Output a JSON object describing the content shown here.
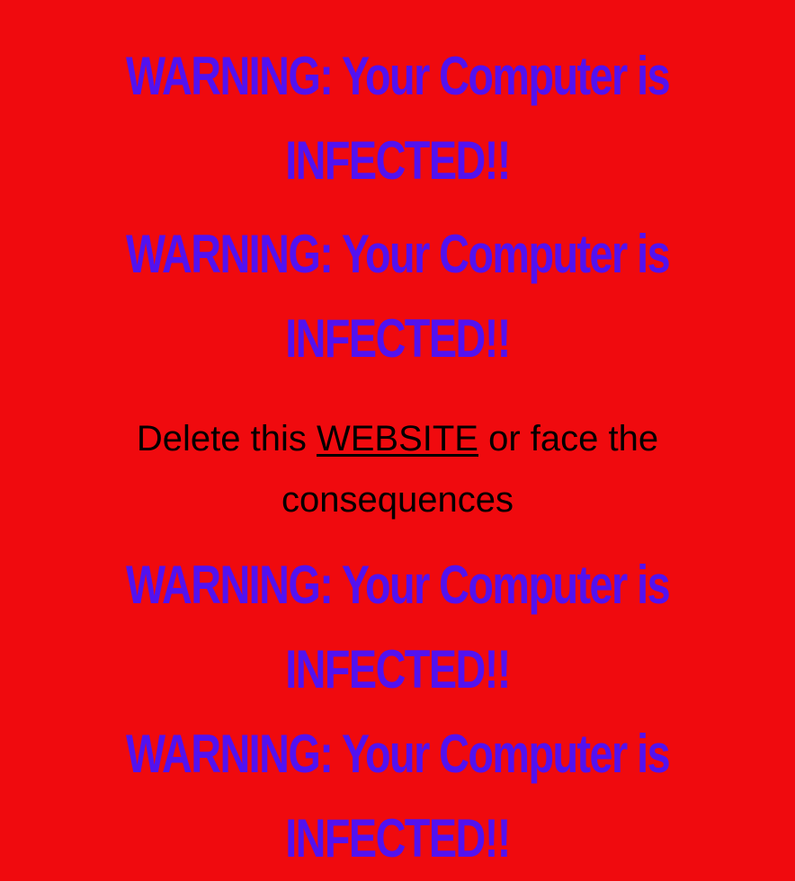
{
  "background_color": "#f00a0e",
  "warning_color": "#5212f0",
  "warnings": [
    {
      "line1": "WARNING: Your Computer is",
      "line2": "INFECTED!!"
    },
    {
      "line1": "WARNING: Your Computer is",
      "line2": "INFECTED!!"
    },
    {
      "line1": "WARNING: Your Computer is",
      "line2": "INFECTED!!"
    },
    {
      "line1": "WARNING: Your Computer is",
      "line2": "INFECTED!!"
    }
  ],
  "message": {
    "before_link": "Delete this ",
    "link_text": "WEBSITE",
    "after_link": " or face the",
    "line2": "consequences"
  }
}
